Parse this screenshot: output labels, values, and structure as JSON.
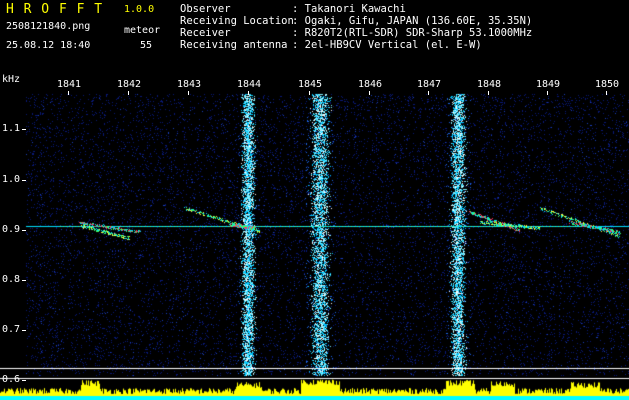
{
  "header": {
    "app_name": "H R O F F T",
    "version": "1.0.0",
    "filename": "2508121840.png",
    "datetime": "25.08.12 18:40",
    "meteor_label": "meteor",
    "meteor_count": "55",
    "info": [
      {
        "key": "Observer",
        "value": ": Takanori Kawachi"
      },
      {
        "key": "Receiving Location",
        "value": ": Ogaki, Gifu, JAPAN (136.60E, 35.35N)"
      },
      {
        "key": "Receiver",
        "value": ": R820T2(RTL-SDR) SDR-Sharp 53.1000MHz"
      },
      {
        "key": "Receiving antenna",
        "value": ": 2el-HB9CV Vertical (el. E-W)"
      }
    ]
  },
  "axis": {
    "unit": "kHz",
    "time_ticks": [
      "1841",
      "1842",
      "1843",
      "1844",
      "1845",
      "1846",
      "1847",
      "1848",
      "1849",
      "1850"
    ],
    "freq_ticks": [
      "1.1",
      "1.0",
      "0.9",
      "0.8",
      "0.7",
      "0.6"
    ]
  },
  "colors": {
    "header_text": "#ffffff",
    "app_name": "#ffff00",
    "background_noise": "#0a1a7a",
    "strong_echo": "#00e5ff",
    "power_trace": "#ffff00",
    "baseline": "#00ffff"
  }
}
